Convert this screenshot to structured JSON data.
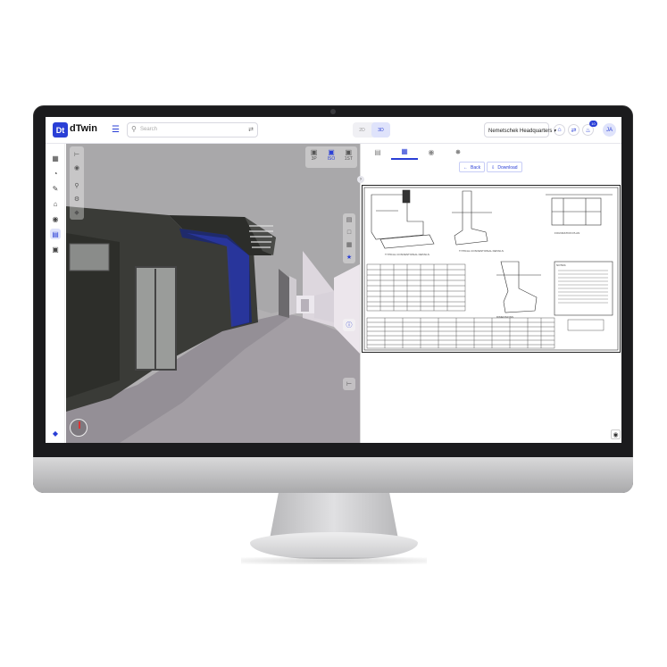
{
  "header": {
    "logo_mark": "Dt",
    "logo_text": "dTwin",
    "search_placeholder": "Search",
    "view_2d": "2D",
    "view_3d": "3D",
    "project_selector": "Nemetschek Headquarters",
    "notification_count": "10",
    "user_initials": "JA"
  },
  "viewport": {
    "camera_modes": [
      "3P",
      "ISO",
      "1ST"
    ]
  },
  "panel": {
    "back_label": "Back",
    "download_label": "Download"
  },
  "colors": {
    "accent": "#2a3fd6",
    "accent_light": "#dfe3fb"
  }
}
